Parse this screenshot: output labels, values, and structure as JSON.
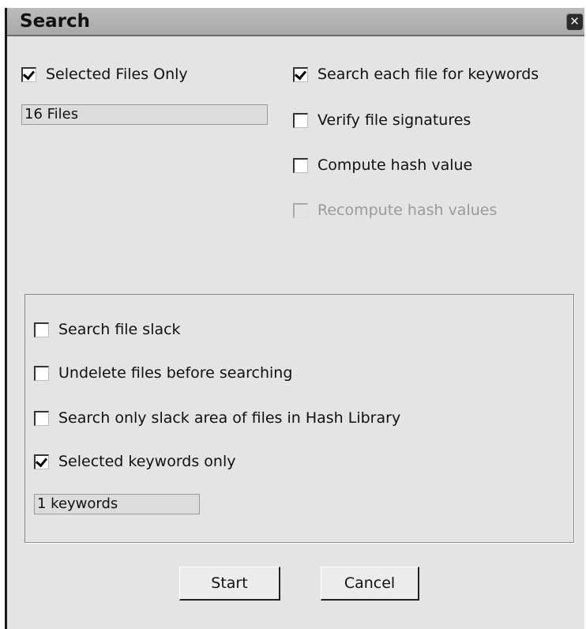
{
  "window": {
    "title": "Search"
  },
  "options": {
    "selected_files_only": {
      "label": "Selected Files Only",
      "checked": true
    },
    "files_count": "16 Files",
    "search_keywords": {
      "label": "Search each file for keywords",
      "checked": true
    },
    "verify_signatures": {
      "label": "Verify file signatures",
      "checked": false
    },
    "compute_hash": {
      "label": "Compute hash value",
      "checked": false
    },
    "recompute_hash": {
      "label": "Recompute hash values",
      "checked": false,
      "enabled": false
    }
  },
  "group": {
    "search_file_slack": {
      "label": "Search file slack",
      "checked": false
    },
    "undelete": {
      "label": "Undelete files before searching",
      "checked": false
    },
    "slack_hash_library": {
      "label": "Search only slack area of files in Hash Library",
      "checked": false
    },
    "selected_keywords": {
      "label": "Selected keywords only",
      "checked": true
    },
    "keywords_count": "1 keywords"
  },
  "buttons": {
    "start": "Start",
    "cancel": "Cancel"
  },
  "icons": {
    "close": "close-icon",
    "checkmark": "checkmark-icon"
  }
}
